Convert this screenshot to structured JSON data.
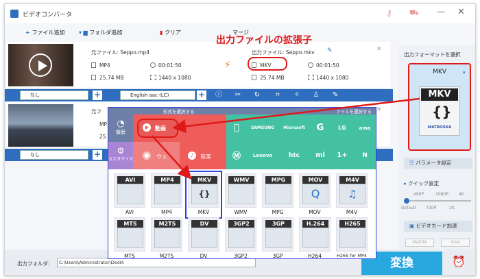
{
  "app": {
    "title": "ビデオコンバータ"
  },
  "toolbar": {
    "add_file": "ファイル追加",
    "add_folder": "フォルダ追加",
    "clear": "クリア",
    "merge_partial": "マージ"
  },
  "annotation": "出力ファイルの拡張子",
  "file1": {
    "source_label": "元ファイル: Seppo.mp4",
    "format": "MP4",
    "duration": "00:01:50",
    "size": "25.74 MB",
    "resolution": "1440 x 1080",
    "output_label": "出力ファイル: Seppo.mkv",
    "out_format": "MKV",
    "out_duration": "00:01:50",
    "out_size": "25.74 MB",
    "out_resolution": "1440 x 1080"
  },
  "file2": {
    "source_label_partial": "元フ",
    "format_partial": "MP",
    "size_partial": "25",
    "out_fragment": "ァイルを選択する"
  },
  "editbar": {
    "subtitle": "なし",
    "audio": "English aac (LC)",
    "subtitle2": "なし"
  },
  "format_panel": {
    "header": "形式を選択する",
    "left_tabs": [
      {
        "label": "履歴"
      },
      {
        "label": "カスタマイズ"
      }
    ],
    "categories": [
      {
        "label": "動画"
      },
      {
        "label": "ウェ"
      },
      {
        "label": "音楽"
      }
    ],
    "brands": [
      "SAMSUNG",
      "Microsoft",
      "G",
      "LG",
      "ama",
      "Lenovo",
      "htc",
      "mi",
      "1+",
      "N"
    ],
    "formats_row1": [
      {
        "code": "AVI",
        "label": "AVI"
      },
      {
        "code": "MP4",
        "label": "MP4"
      },
      {
        "code": "MKV",
        "label": "MKV"
      },
      {
        "code": "WMV",
        "label": "WMV"
      },
      {
        "code": "MPG",
        "label": "MPG"
      },
      {
        "code": "MOV",
        "label": "MOV"
      },
      {
        "code": "M4V",
        "label": "M4V"
      }
    ],
    "formats_row2": [
      {
        "code": "MTS",
        "label": "MTS"
      },
      {
        "code": "M2TS",
        "label": "M2TS"
      },
      {
        "code": "DV",
        "label": "DV"
      },
      {
        "code": "3GP2",
        "label": "3GP2"
      },
      {
        "code": "3GP",
        "label": "3GP"
      },
      {
        "code": "H.264",
        "label": "H264"
      },
      {
        "code": "H265",
        "label": "H265 for MP4"
      }
    ]
  },
  "right_panel": {
    "title": "出力フォーマットを選択",
    "format": "MKV",
    "mkv_code": "MKV",
    "matroska": "MATROŠKA",
    "params": "パラメータ設定",
    "quick": "クイック設定",
    "quality_top": [
      "480P",
      "1080P",
      "4K"
    ],
    "quality_bottom": [
      "Default",
      "720P",
      "2K"
    ],
    "gpu": "ビデオカード加速",
    "vendors": [
      "NVIDIA",
      "Intel"
    ]
  },
  "bottom": {
    "output_folder_label": "出力フォルダ:",
    "output_path": "C:\\Users\\Administrator\\Deskt",
    "convert": "変換"
  },
  "colors": {
    "accent": "#2f6ebf",
    "convert": "#29a8e0",
    "annotation": "#e01818",
    "category": "#ef5d5a",
    "brand": "#44c1a3"
  }
}
